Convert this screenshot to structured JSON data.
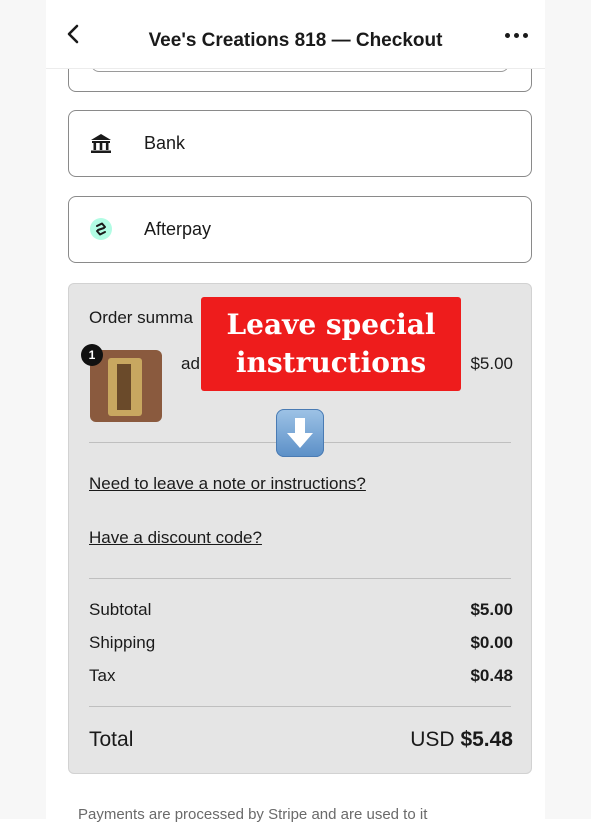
{
  "header": {
    "title": "Vee's Creations 818 — Checkout"
  },
  "payment_methods": [
    {
      "label": "Bank",
      "icon": "bank-icon"
    },
    {
      "label": "Afterpay",
      "icon": "afterpay-icon"
    }
  ],
  "summary": {
    "title": "Order summa",
    "item": {
      "quantity": "1",
      "name": "ad",
      "price": "$5.00"
    },
    "note_link": "Need to leave a note or instructions?",
    "discount_link": "Have a discount code?",
    "rows": [
      {
        "label": "Subtotal",
        "value": "$5.00"
      },
      {
        "label": "Shipping",
        "value": "$0.00"
      },
      {
        "label": "Tax",
        "value": "$0.48"
      }
    ],
    "total_label": "Total",
    "total_currency": "USD",
    "total_value": "$5.48"
  },
  "overlay": {
    "line1": "Leave special",
    "line2": "instructions"
  },
  "footer": {
    "text": "Payments are processed by Stripe and are used to it"
  },
  "colors": {
    "overlay": "#ee1c1c",
    "summary_bg": "#e5e5e5",
    "afterpay": "#b2fce4"
  }
}
